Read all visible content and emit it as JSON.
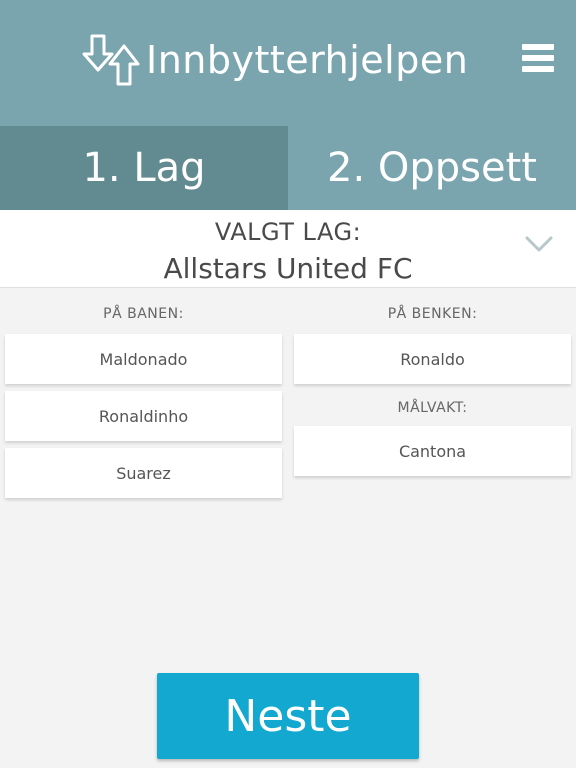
{
  "header": {
    "logo_text": "Innbytterhjelpen",
    "logo_icon": "swap-arrows-icon",
    "menu_icon": "hamburger-menu-icon",
    "background_color": "#7aa5ae"
  },
  "tabs": [
    {
      "label": "1. Lag",
      "active": true
    },
    {
      "label": "2. Oppsett",
      "active": false
    }
  ],
  "team_select": {
    "caption": "VALGT LAG:",
    "team_name": "Allstars United FC",
    "icon": "chevron-down-icon"
  },
  "on_field": {
    "header": "PÅ BANEN:",
    "players": [
      "Maldonado",
      "Ronaldinho",
      "Suarez"
    ]
  },
  "bench": {
    "header": "PÅ BENKEN:",
    "players": [
      "Ronaldo"
    ]
  },
  "goalkeeper": {
    "header": "MÅLVAKT:",
    "players": [
      "Cantona"
    ]
  },
  "next_button": {
    "label": "Neste",
    "color": "#12a8cf"
  }
}
